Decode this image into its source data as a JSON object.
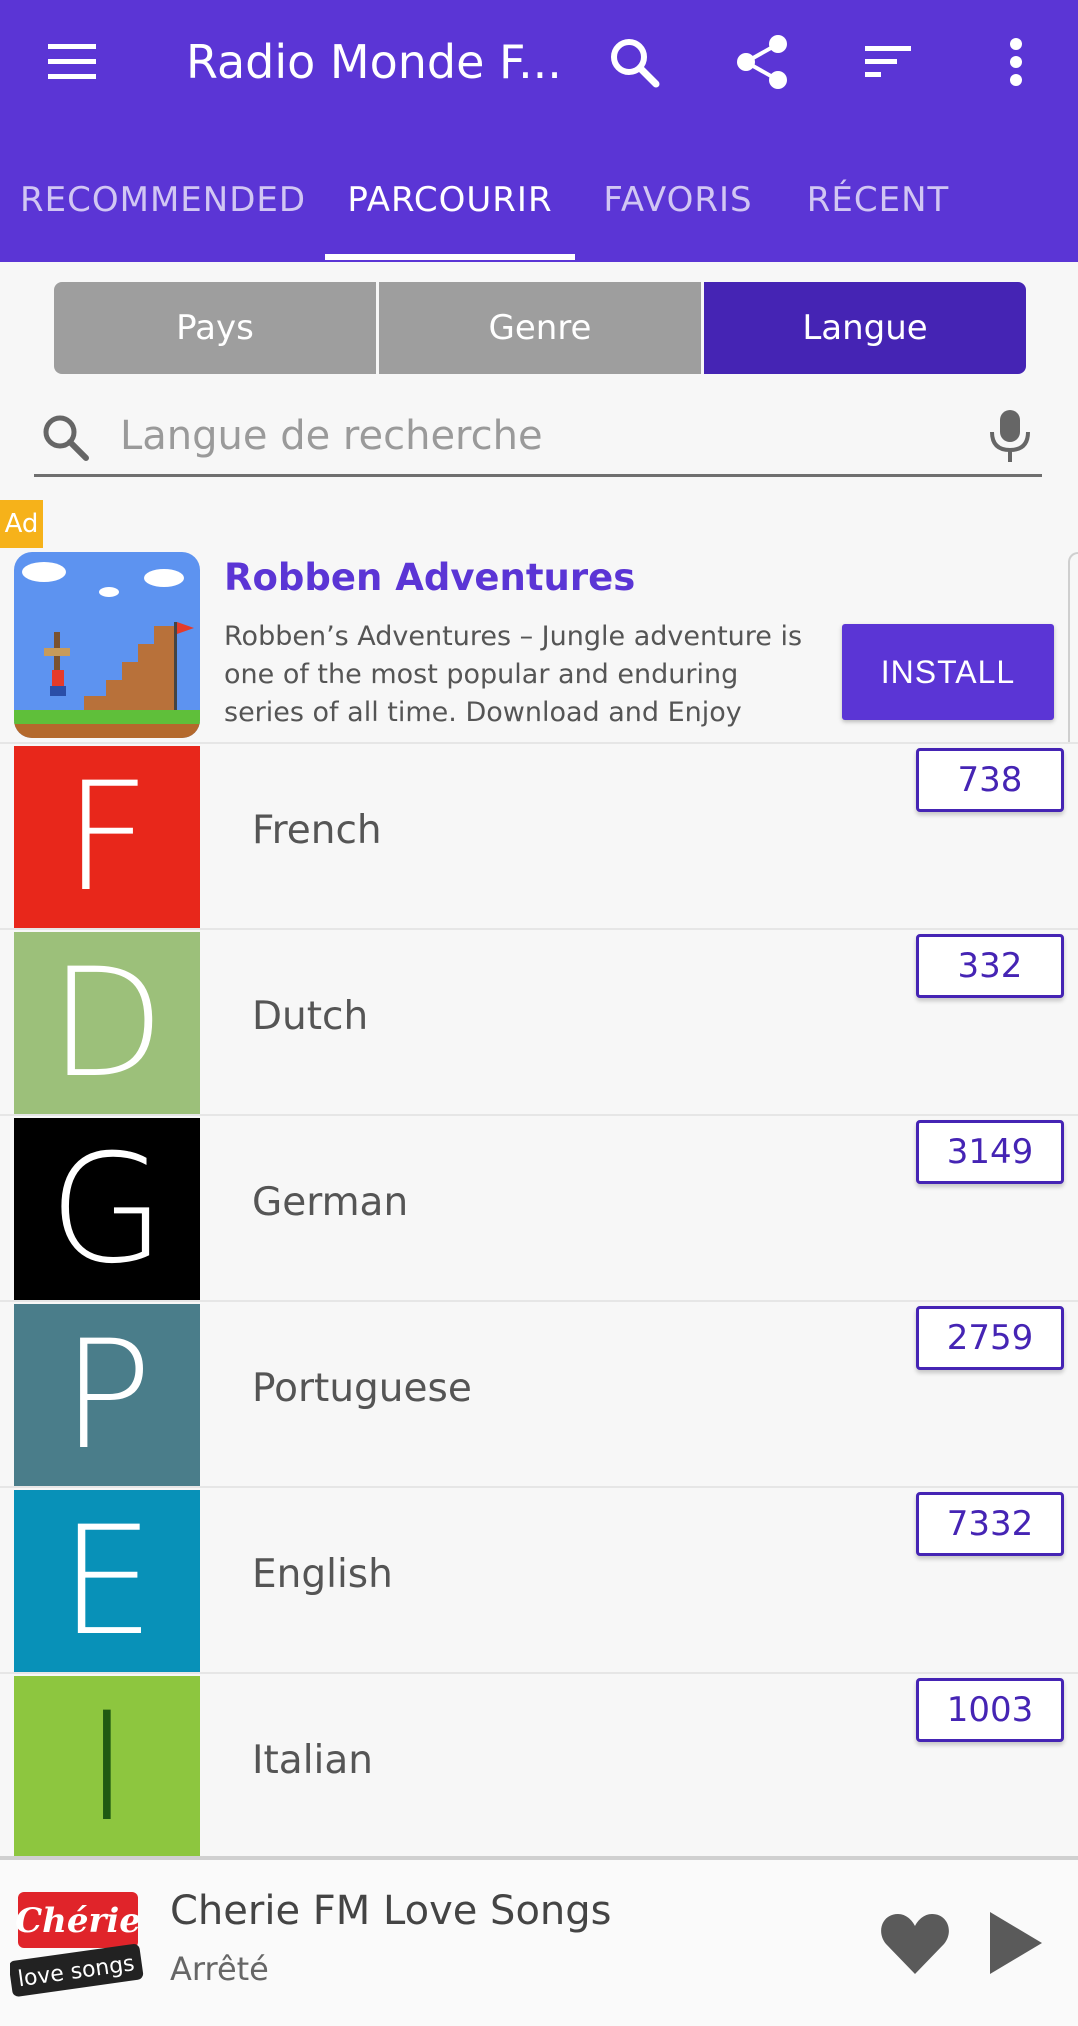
{
  "appbar": {
    "title": "Radio Monde F...",
    "icons": [
      "menu-icon",
      "search-icon",
      "share-icon",
      "sort-icon",
      "more-vertical-icon"
    ],
    "color": "#5b35d5"
  },
  "tabs": [
    {
      "label": "RECOMMENDED",
      "active": false
    },
    {
      "label": "PARCOURIR",
      "active": true
    },
    {
      "label": "FAVORIS",
      "active": false
    },
    {
      "label": "RÉCENT",
      "active": false
    }
  ],
  "segments": [
    {
      "label": "Pays",
      "selected": false
    },
    {
      "label": "Genre",
      "selected": false
    },
    {
      "label": "Langue",
      "selected": true
    }
  ],
  "search": {
    "placeholder": "Langue de recherche",
    "value": ""
  },
  "ad": {
    "badge": "Ad",
    "title": "Robben Adventures",
    "description": "Robben’s Adventures – Jungle adventure is one of the most popular and enduring series of all time. Download and Enjoy",
    "button": "INSTALL"
  },
  "languages": [
    {
      "letter": "F",
      "name": "French",
      "count": "738",
      "color": "#e8271b"
    },
    {
      "letter": "D",
      "name": "Dutch",
      "count": "332",
      "color": "#9cc07a"
    },
    {
      "letter": "G",
      "name": "German",
      "count": "3149",
      "color": "#000000"
    },
    {
      "letter": "P",
      "name": "Portuguese",
      "count": "2759",
      "color": "#4a7d8a"
    },
    {
      "letter": "E",
      "name": "English",
      "count": "7332",
      "color": "#0891b8"
    },
    {
      "letter": "I",
      "name": "Italian",
      "count": "1003",
      "color": "#8dc63f",
      "letter_color": "#1f5a12"
    }
  ],
  "player": {
    "logo_text_top": "Chérie",
    "logo_text_bottom": "love songs",
    "station": "Cherie FM Love Songs",
    "status": "Arrêté"
  }
}
